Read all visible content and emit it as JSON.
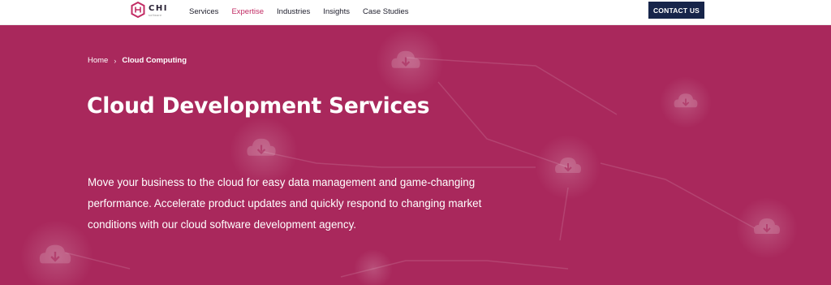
{
  "brand": {
    "name": "CHI",
    "sub": "software"
  },
  "nav": {
    "items": [
      {
        "label": "Services",
        "active": false
      },
      {
        "label": "Expertise",
        "active": true
      },
      {
        "label": "Industries",
        "active": false
      },
      {
        "label": "Insights",
        "active": false
      },
      {
        "label": "Case Studies",
        "active": false
      }
    ],
    "cta": "CONTACT US"
  },
  "breadcrumb": {
    "home": "Home",
    "separator": "›",
    "current": "Cloud Computing"
  },
  "hero": {
    "title": "Cloud Development Services",
    "description": "Move your business to the cloud for easy data management and game-changing performance. Accelerate product updates and quickly respond to changing market conditions with our cloud software development agency."
  },
  "colors": {
    "hero_bg": "#a9285c",
    "accent": "#c22c64",
    "cta_bg": "#17254a",
    "nav_text": "#1d1d2b"
  }
}
